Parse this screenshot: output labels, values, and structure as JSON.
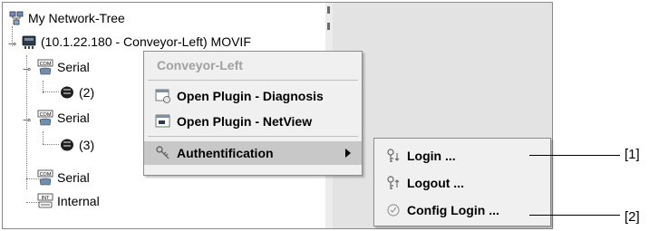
{
  "tree": {
    "root_label": "My Network-Tree",
    "device_label": "(10.1.22.180 - Conveyor-Left) MOVIF",
    "serial_1": "Serial",
    "node_2": "(2)",
    "serial_2": "Serial",
    "node_3": "(3)",
    "serial_3": "Serial",
    "internal": "Internal",
    "badge_com": "COM",
    "badge_int": "INT"
  },
  "context_menu": {
    "header": "Conveyor-Left",
    "open_diagnosis": "Open Plugin - Diagnosis",
    "open_netview": "Open Plugin - NetView",
    "authentification": "Authentification"
  },
  "submenu": {
    "login": "Login ...",
    "logout": "Logout ...",
    "config_login": "Config Login ..."
  },
  "callouts": {
    "one": "[1]",
    "two": "[2]"
  }
}
